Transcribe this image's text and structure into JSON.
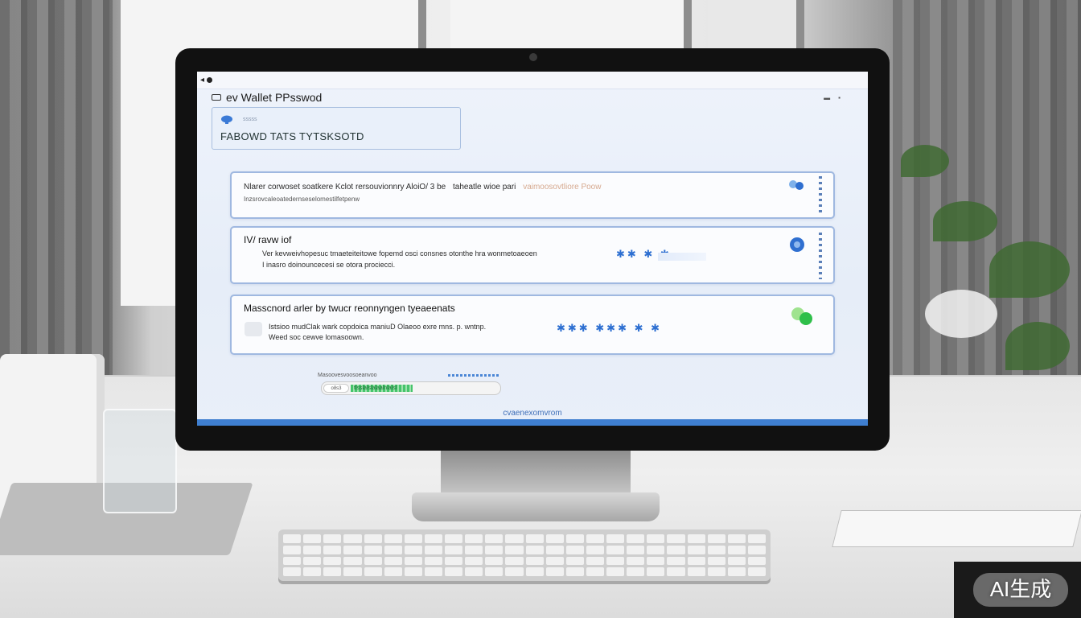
{
  "window": {
    "back_label": "",
    "title": "ev Wallet PPsswod"
  },
  "header_card": {
    "small_label": "sssss",
    "caption": "FABOWD TATS TYTSKSOTD"
  },
  "cards": [
    {
      "line1": "Nlarer corwoset soatkere Kclot rersouvionnry AloiO/ 3 be",
      "line1_tail": "taheatle wioe pari",
      "line1_faded": "vaimoosovtliore Poow",
      "line2": "Inzsrovcaleoatedernseselomestilfetpenw"
    },
    {
      "heading": "IV/ ravw iof",
      "line1": "Ver kevweivhopesuc tmaeteiteitowe fopemd osci consnes otonthe hra wonmetoaeoen",
      "line2": "I inasro doinouncecesi se otora prociecci."
    },
    {
      "heading": "Masscnord arler by twucr reonnyngen tyeaeenats",
      "line1": "Istsioo mudClak wark copdoica maniuD Olaeoo exre mns. p. wntnp.",
      "line2": "Weed soc cewve lomasoown."
    }
  ],
  "stepper": {
    "label": "Masoovesvoosoeanvoo",
    "pill": "o8s3",
    "progress_text": "tlsslalslalaalnlalsl",
    "progress_fraction": 0.42
  },
  "footer_link": "cvaenexomvrom",
  "watermark": "AI生成",
  "colors": {
    "accent": "#3f7fd0",
    "card_border": "#9fb8e0",
    "progress": "#46c46b"
  }
}
